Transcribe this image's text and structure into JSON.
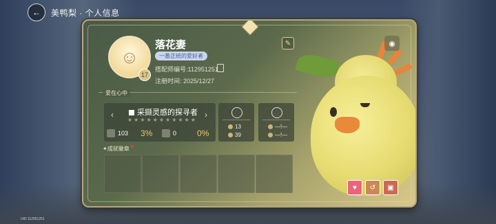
{
  "topbar": {
    "breadcrumb": "美鸭梨 · 个人信息"
  },
  "profile": {
    "name": "落花妻",
    "title_tag": "一番正统的爱好者",
    "level": "17",
    "player_id": "搭配师编号:112951251",
    "register_date": "注册时间: 2025/12/27"
  },
  "section": {
    "label": "爱在心中"
  },
  "achievement": {
    "title": "采撷灵感的探寻者",
    "stars": "★★★★★★★★★★★",
    "stat1_value": "103",
    "stat1_pct": "3%",
    "stat2_value": "0",
    "stat2_pct": "0%"
  },
  "mini1": {
    "row1": "13",
    "row2": "39"
  },
  "mini2": {
    "row1": "—!—",
    "row2": "—!—"
  },
  "badges": {
    "label": "✦成就徽章"
  },
  "corner": {
    "uid": "UID 112951251"
  },
  "icons": [
    "back-icon",
    "copy-icon",
    "edit-icon",
    "eye-icon",
    "like-icon",
    "share-icon",
    "photo-icon"
  ]
}
